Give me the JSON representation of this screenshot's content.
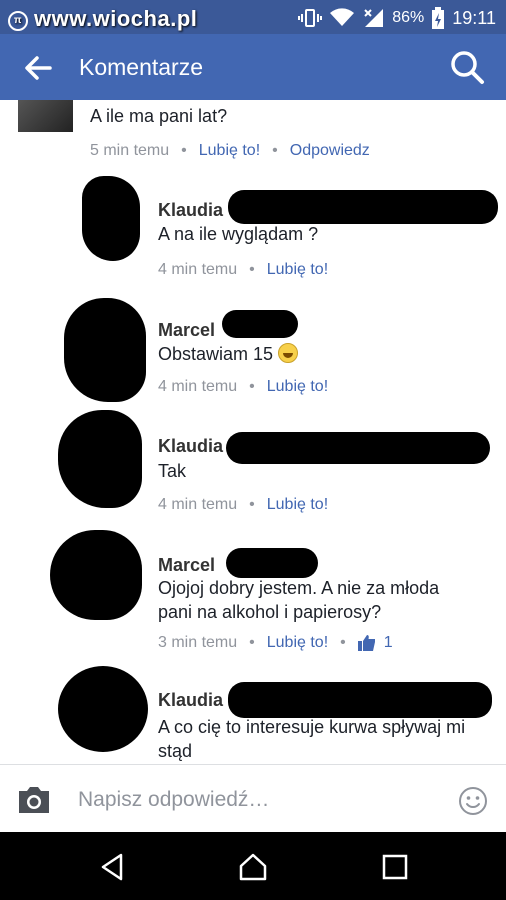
{
  "status_bar": {
    "watermark": "www.wiocha.pl",
    "battery": "86%",
    "time": "19:11"
  },
  "app_bar": {
    "title": "Komentarze"
  },
  "comments": [
    {
      "name": "",
      "text": "A ile ma pani lat?",
      "time": "5 min temu",
      "like": "Lubię to!",
      "reply": "Odpowiedz"
    },
    {
      "name": "Klaudia",
      "text": "A na ile wyglądam ?",
      "time": "4 min temu",
      "like": "Lubię to!"
    },
    {
      "name": "Marcel",
      "text": "Obstawiam 15",
      "time": "4 min temu",
      "like": "Lubię to!"
    },
    {
      "name": "Klaudia",
      "text": "Tak",
      "time": "4 min temu",
      "like": "Lubię to!"
    },
    {
      "name": "Marcel",
      "text": "Ojojoj dobry jestem. A nie za młoda pani na alkohol i papierosy?",
      "time": "3 min temu",
      "like": "Lubię to!",
      "like_count": "1"
    },
    {
      "name": "Klaudia",
      "text": "A co cię to interesuje kurwa spływaj mi stąd"
    }
  ],
  "composer": {
    "placeholder": "Napisz odpowiedź…"
  },
  "colors": {
    "brand": "#4267b2",
    "status_bar": "#3b5998",
    "meta_gray": "#90949c"
  }
}
